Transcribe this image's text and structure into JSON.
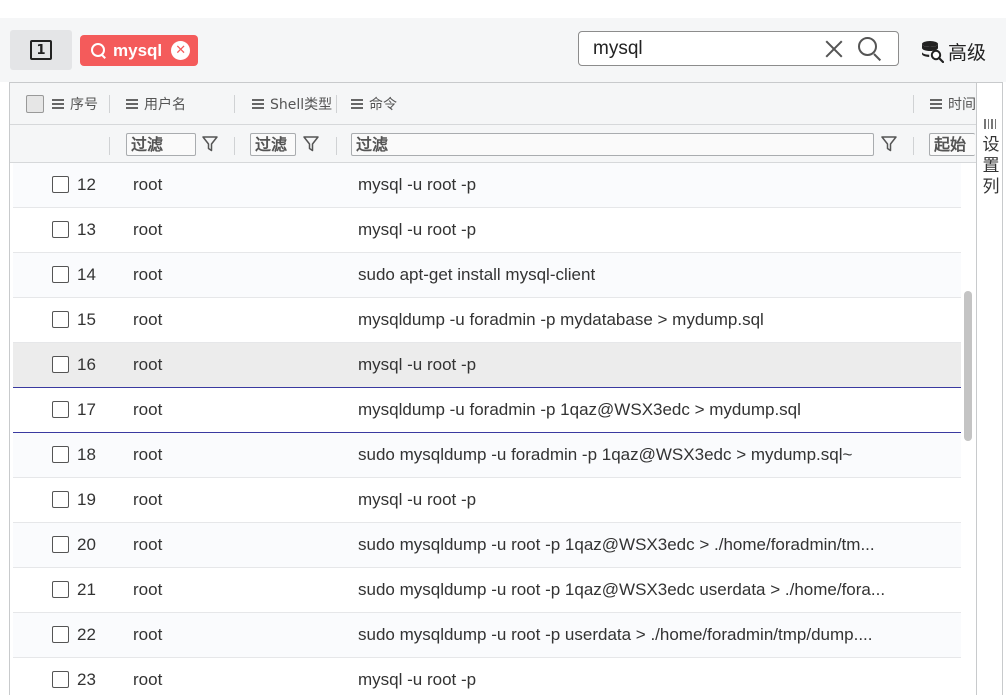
{
  "toolbar": {
    "page_number": "1",
    "filter_tag": {
      "label": "mysql"
    },
    "search": {
      "value": "mysql"
    },
    "advanced_label": "高级"
  },
  "grid": {
    "columns": [
      {
        "label": "序号"
      },
      {
        "label": "用户名"
      },
      {
        "label": "Shell类型"
      },
      {
        "label": "命令"
      },
      {
        "label": "时间"
      }
    ],
    "filter_placeholders": {
      "user": "过滤",
      "shell": "过滤",
      "command": "过滤",
      "time": "起始"
    },
    "rows": [
      {
        "num": "12",
        "user": "root",
        "command": "mysql -u root -p"
      },
      {
        "num": "13",
        "user": "root",
        "command": "mysql -u root -p"
      },
      {
        "num": "14",
        "user": "root",
        "command": "sudo apt-get install mysql-client"
      },
      {
        "num": "15",
        "user": "root",
        "command": "mysqldump -u foradmin -p mydatabase > mydump.sql"
      },
      {
        "num": "16",
        "user": "root",
        "command": "mysql -u root -p"
      },
      {
        "num": "17",
        "user": "root",
        "command": "mysqldump -u foradmin -p 1qaz@WSX3edc > mydump.sql"
      },
      {
        "num": "18",
        "user": "root",
        "command": "sudo mysqldump -u foradmin -p 1qaz@WSX3edc > mydump.sql~"
      },
      {
        "num": "19",
        "user": "root",
        "command": "mysql -u root -p"
      },
      {
        "num": "20",
        "user": "root",
        "command": "sudo mysqldump -u root -p 1qaz@WSX3edc > ./home/foradmin/tm..."
      },
      {
        "num": "21",
        "user": "root",
        "command": "sudo mysqldump -u root -p 1qaz@WSX3edc userdata > ./home/fora..."
      },
      {
        "num": "22",
        "user": "root",
        "command": "sudo mysqldump -u root -p userdata > ./home/foradmin/tmp/dump...."
      },
      {
        "num": "23",
        "user": "root",
        "command": "mysql -u root -p"
      }
    ],
    "column_panel_label": "设置列"
  },
  "colors": {
    "tag_bg": "#f45b5b",
    "hover_row": "#ececec",
    "selected_border": "#3a3aa0"
  }
}
